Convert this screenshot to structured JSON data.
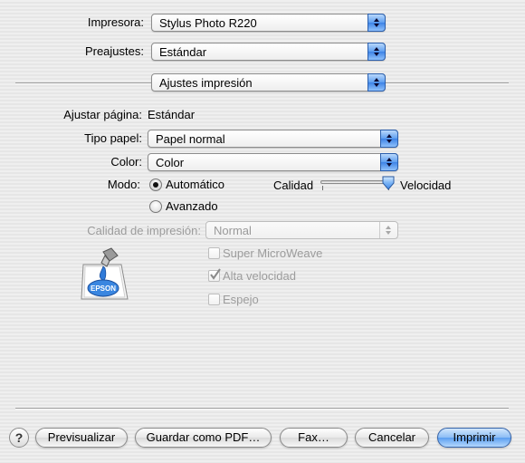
{
  "printer": {
    "label": "Impresora:",
    "value": "Stylus Photo R220"
  },
  "presets": {
    "label": "Preajustes:",
    "value": "Estándar"
  },
  "pane": {
    "value": "Ajustes impresión"
  },
  "page_setup": {
    "label": "Ajustar página:",
    "value": "Estándar"
  },
  "paper_type": {
    "label": "Tipo papel:",
    "value": "Papel normal"
  },
  "color": {
    "label": "Color:",
    "value": "Color"
  },
  "mode": {
    "label": "Modo:",
    "options": [
      "Automático",
      "Avanzado"
    ],
    "selected": "Automático",
    "slider": {
      "left_label": "Calidad",
      "right_label": "Velocidad",
      "position": 1.0
    }
  },
  "print_quality": {
    "label": "Calidad de impresión:",
    "value": "Normal",
    "enabled": false
  },
  "checkboxes": [
    {
      "label": "Super MicroWeave",
      "checked": false,
      "enabled": false
    },
    {
      "label": "Alta velocidad",
      "checked": true,
      "enabled": false
    },
    {
      "label": "Espejo",
      "checked": false,
      "enabled": false
    }
  ],
  "logo": {
    "text": "EPSON"
  },
  "buttons": {
    "help": "?",
    "preview": "Previsualizar",
    "save_pdf": "Guardar como PDF…",
    "fax": "Fax…",
    "cancel": "Cancelar",
    "print": "Imprimir"
  },
  "colors": {
    "accent": "#5b9ef0",
    "disabled_text": "#9c9c9c"
  }
}
